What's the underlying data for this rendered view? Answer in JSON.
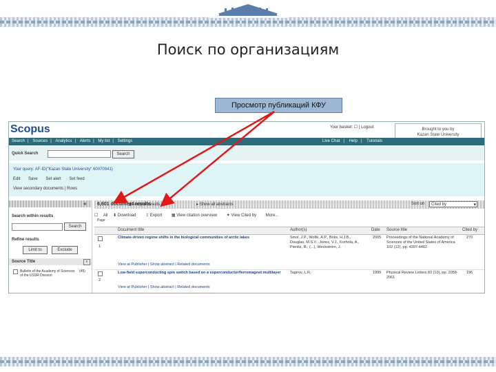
{
  "slide": {
    "title": "Поиск по организациям",
    "callout": "Просмотр публикаций КФУ"
  },
  "scopus": {
    "brand": "Scopus",
    "top_links": "Your basket: ☐ | Logout",
    "institution": [
      "Brought to you by",
      "Kazan State University"
    ],
    "nav": [
      "Search",
      "Sources",
      "Analytics",
      "Alerts",
      "My list",
      "Settings"
    ],
    "nav_right": [
      "Live Chat",
      "Help",
      "Tutorials"
    ],
    "quick_search": {
      "label": "Quick Search",
      "button": "Search"
    },
    "query": {
      "text": "Your query: AF-ID(\"Kazan State University\" 60070941)",
      "actions": [
        "Edit",
        "Save",
        "Set alert",
        "Set feed"
      ],
      "extra": "View secondary documents | Rows"
    },
    "left": {
      "collapse": "«",
      "search_within_label": "Search within results",
      "search_button": "Search",
      "refine_label": "Refine results",
      "limit_button": "Limit to",
      "exclude_button": "Exclude",
      "source_title_label": "Source Title",
      "source_items": [
        {
          "name": "Bulletin of the Academy of Sciences of the USSR Division",
          "count": "(45)"
        }
      ]
    },
    "results": {
      "count": "6,601 document results",
      "analyze": "Analyze results",
      "show_all": "Show all abstracts",
      "sort_label": "Sort on",
      "sort_value": "Cited by",
      "toolbar": [
        "All",
        "Download",
        "Export",
        "View citation overview",
        "View Cited by",
        "More..."
      ],
      "page_label": "Page",
      "headers": [
        "Document title",
        "Author(s)",
        "Date",
        "Source title",
        "Cited by"
      ],
      "rows": [
        {
          "num": "1",
          "title": "Climate-driven regime shifts in the biological communities of arctic lakes",
          "authors": "Smol, J.P., Wolfe, A.P., Birks, H.J.B., Douglas, M.S.V., Jones, V.J., Korhola, A., Pienitz, R., (...), Weckström, J.",
          "date": "2005",
          "source": "Proceedings of the National Academy of Sciences of the United States of America 102 (12), pp. 4397-4402",
          "cited": "270",
          "links": "View at Publisher | Show abstract | Related documents"
        },
        {
          "num": "2",
          "title": "Low-field superconducting spin switch based on a superconductor/ferromagnet multilayer",
          "authors": "Tagirov, L.R.",
          "date": "1999",
          "source": "Physical Review Letters 83 (10), pp. 2058-2061",
          "cited": "196",
          "links": "View at Publisher | Show abstract | Related documents"
        }
      ]
    }
  }
}
